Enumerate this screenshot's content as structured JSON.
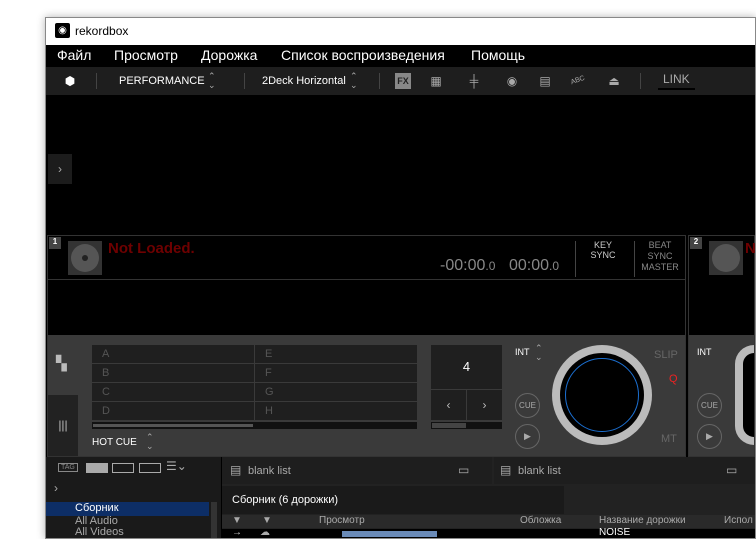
{
  "window": {
    "title": "rekordbox"
  },
  "menu": [
    "Файл",
    "Просмотр",
    "Дорожка",
    "Список воспроизведения",
    "Помощь"
  ],
  "toolbar": {
    "mode": "PERFORMANCE",
    "layout": "2Deck Horizontal",
    "fx": "FX",
    "abc": "ABC",
    "link": "LINK"
  },
  "deck1": {
    "number": "1",
    "status": "Not Loaded.",
    "remaining": "-00:00",
    "remaining_frac": ".0",
    "elapsed": "00:00",
    "elapsed_frac": ".0",
    "key": "KEY",
    "key_sync": "SYNC",
    "beat": "BEAT",
    "beat_sync": "SYNC",
    "master": "MASTER",
    "pads": [
      "A",
      "B",
      "C",
      "D",
      "E",
      "F",
      "G",
      "H"
    ],
    "pad_mode": "HOT CUE",
    "beat_loop": "4",
    "int": "INT",
    "cue": "CUE",
    "slip": "SLIP",
    "q": "Q",
    "mt": "MT"
  },
  "deck2": {
    "number": "2",
    "status": "N",
    "int": "INT",
    "cue": "CUE"
  },
  "browser": {
    "tag": "TAG",
    "tree": [
      "Сборник",
      "All Audio",
      "All Videos"
    ],
    "lists": [
      {
        "label": "blank list"
      },
      {
        "label": "blank list"
      }
    ],
    "collection_title": "Сборник (6 дорожки)",
    "columns": [
      "Просмотр",
      "Обложка",
      "Название дорожки",
      "Испол"
    ],
    "rows": [
      {
        "title": "NOISE"
      }
    ]
  }
}
